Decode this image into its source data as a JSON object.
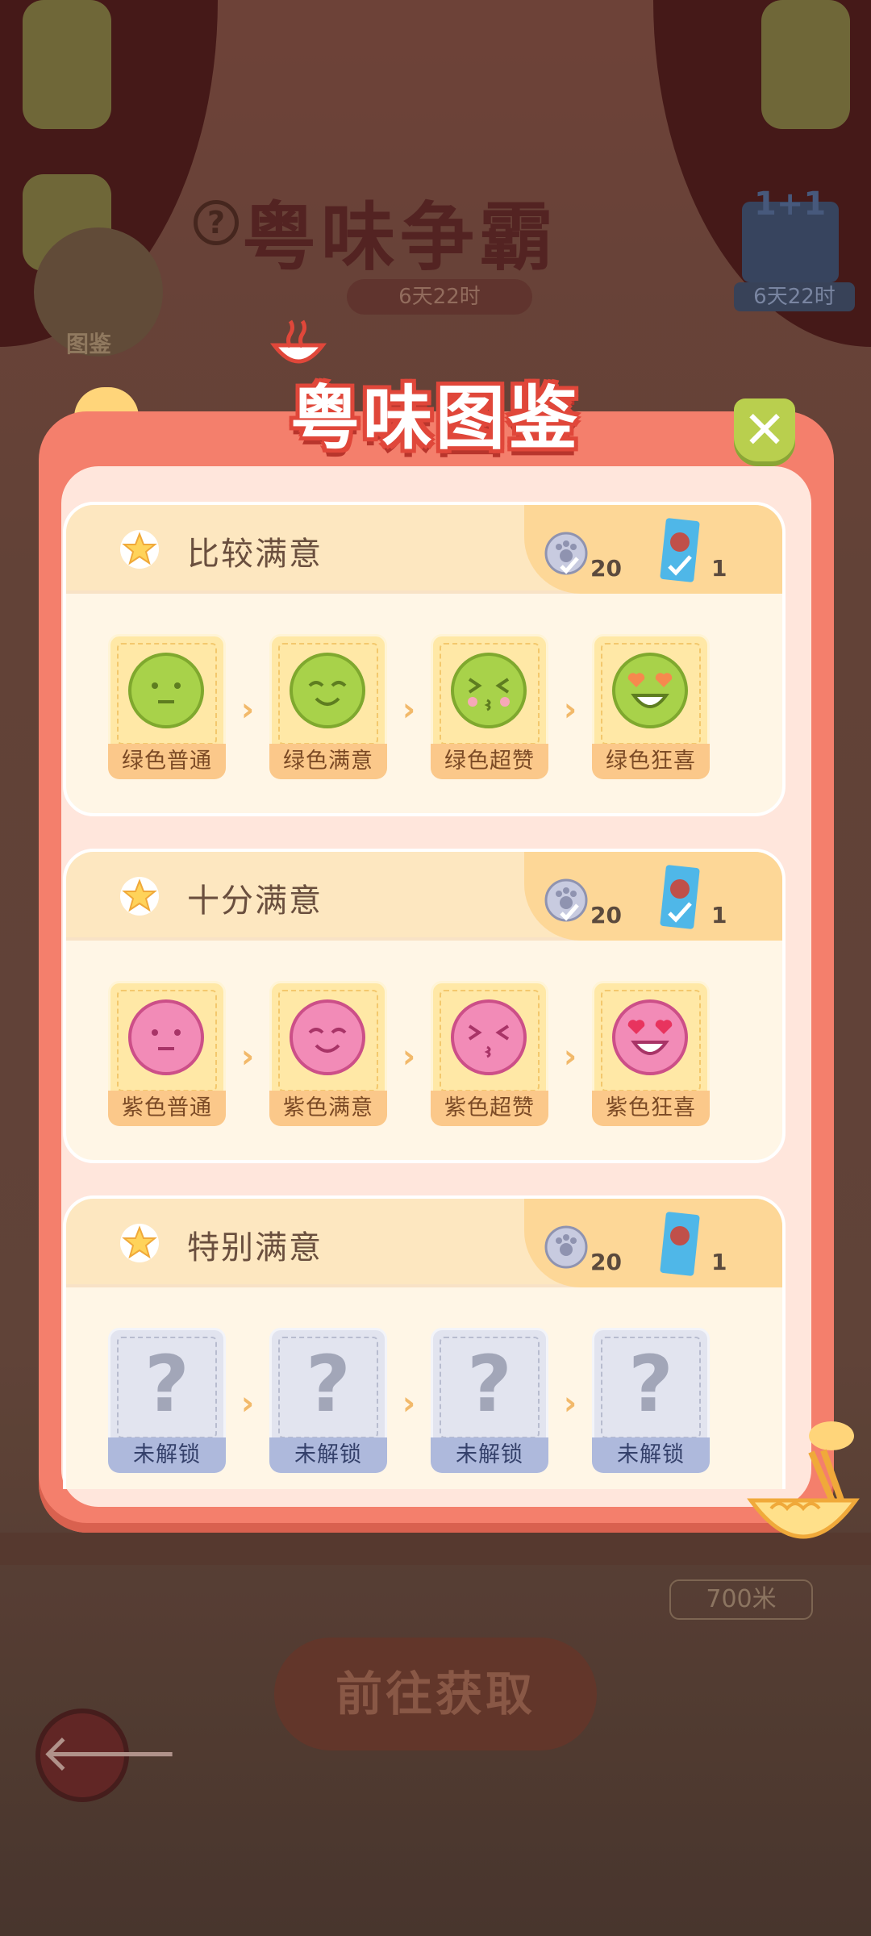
{
  "background": {
    "event_title": "粤味争霸",
    "event_timer": "6天22时",
    "side_timer": "6天22时",
    "gift_label": "1+1",
    "guide_label": "图鉴",
    "help_symbol": "?",
    "distance": "700米",
    "go_button": "前往获取",
    "back_symbol": "🡐"
  },
  "modal": {
    "title": "粤味图鉴",
    "close_symbol": "✕",
    "sections": [
      {
        "title": "比较满意",
        "coin_reward": "20",
        "card_reward": "1",
        "stages": [
          "绿色普通",
          "绿色满意",
          "绿色超赞",
          "绿色狂喜"
        ],
        "color": "#a8d24a"
      },
      {
        "title": "十分满意",
        "coin_reward": "20",
        "card_reward": "1",
        "stages": [
          "紫色普通",
          "紫色满意",
          "紫色超赞",
          "紫色狂喜"
        ],
        "color": "#f28bb7"
      },
      {
        "title": "特别满意",
        "coin_reward": "20",
        "card_reward": "1",
        "stages": [
          "未解锁",
          "未解锁",
          "未解锁",
          "未解锁"
        ],
        "locked_symbol": "?"
      }
    ],
    "chevron": "›"
  },
  "icons": {
    "star": "star-icon",
    "coin": "paw-coin-icon",
    "card": "character-card-icon",
    "close": "close-icon"
  }
}
